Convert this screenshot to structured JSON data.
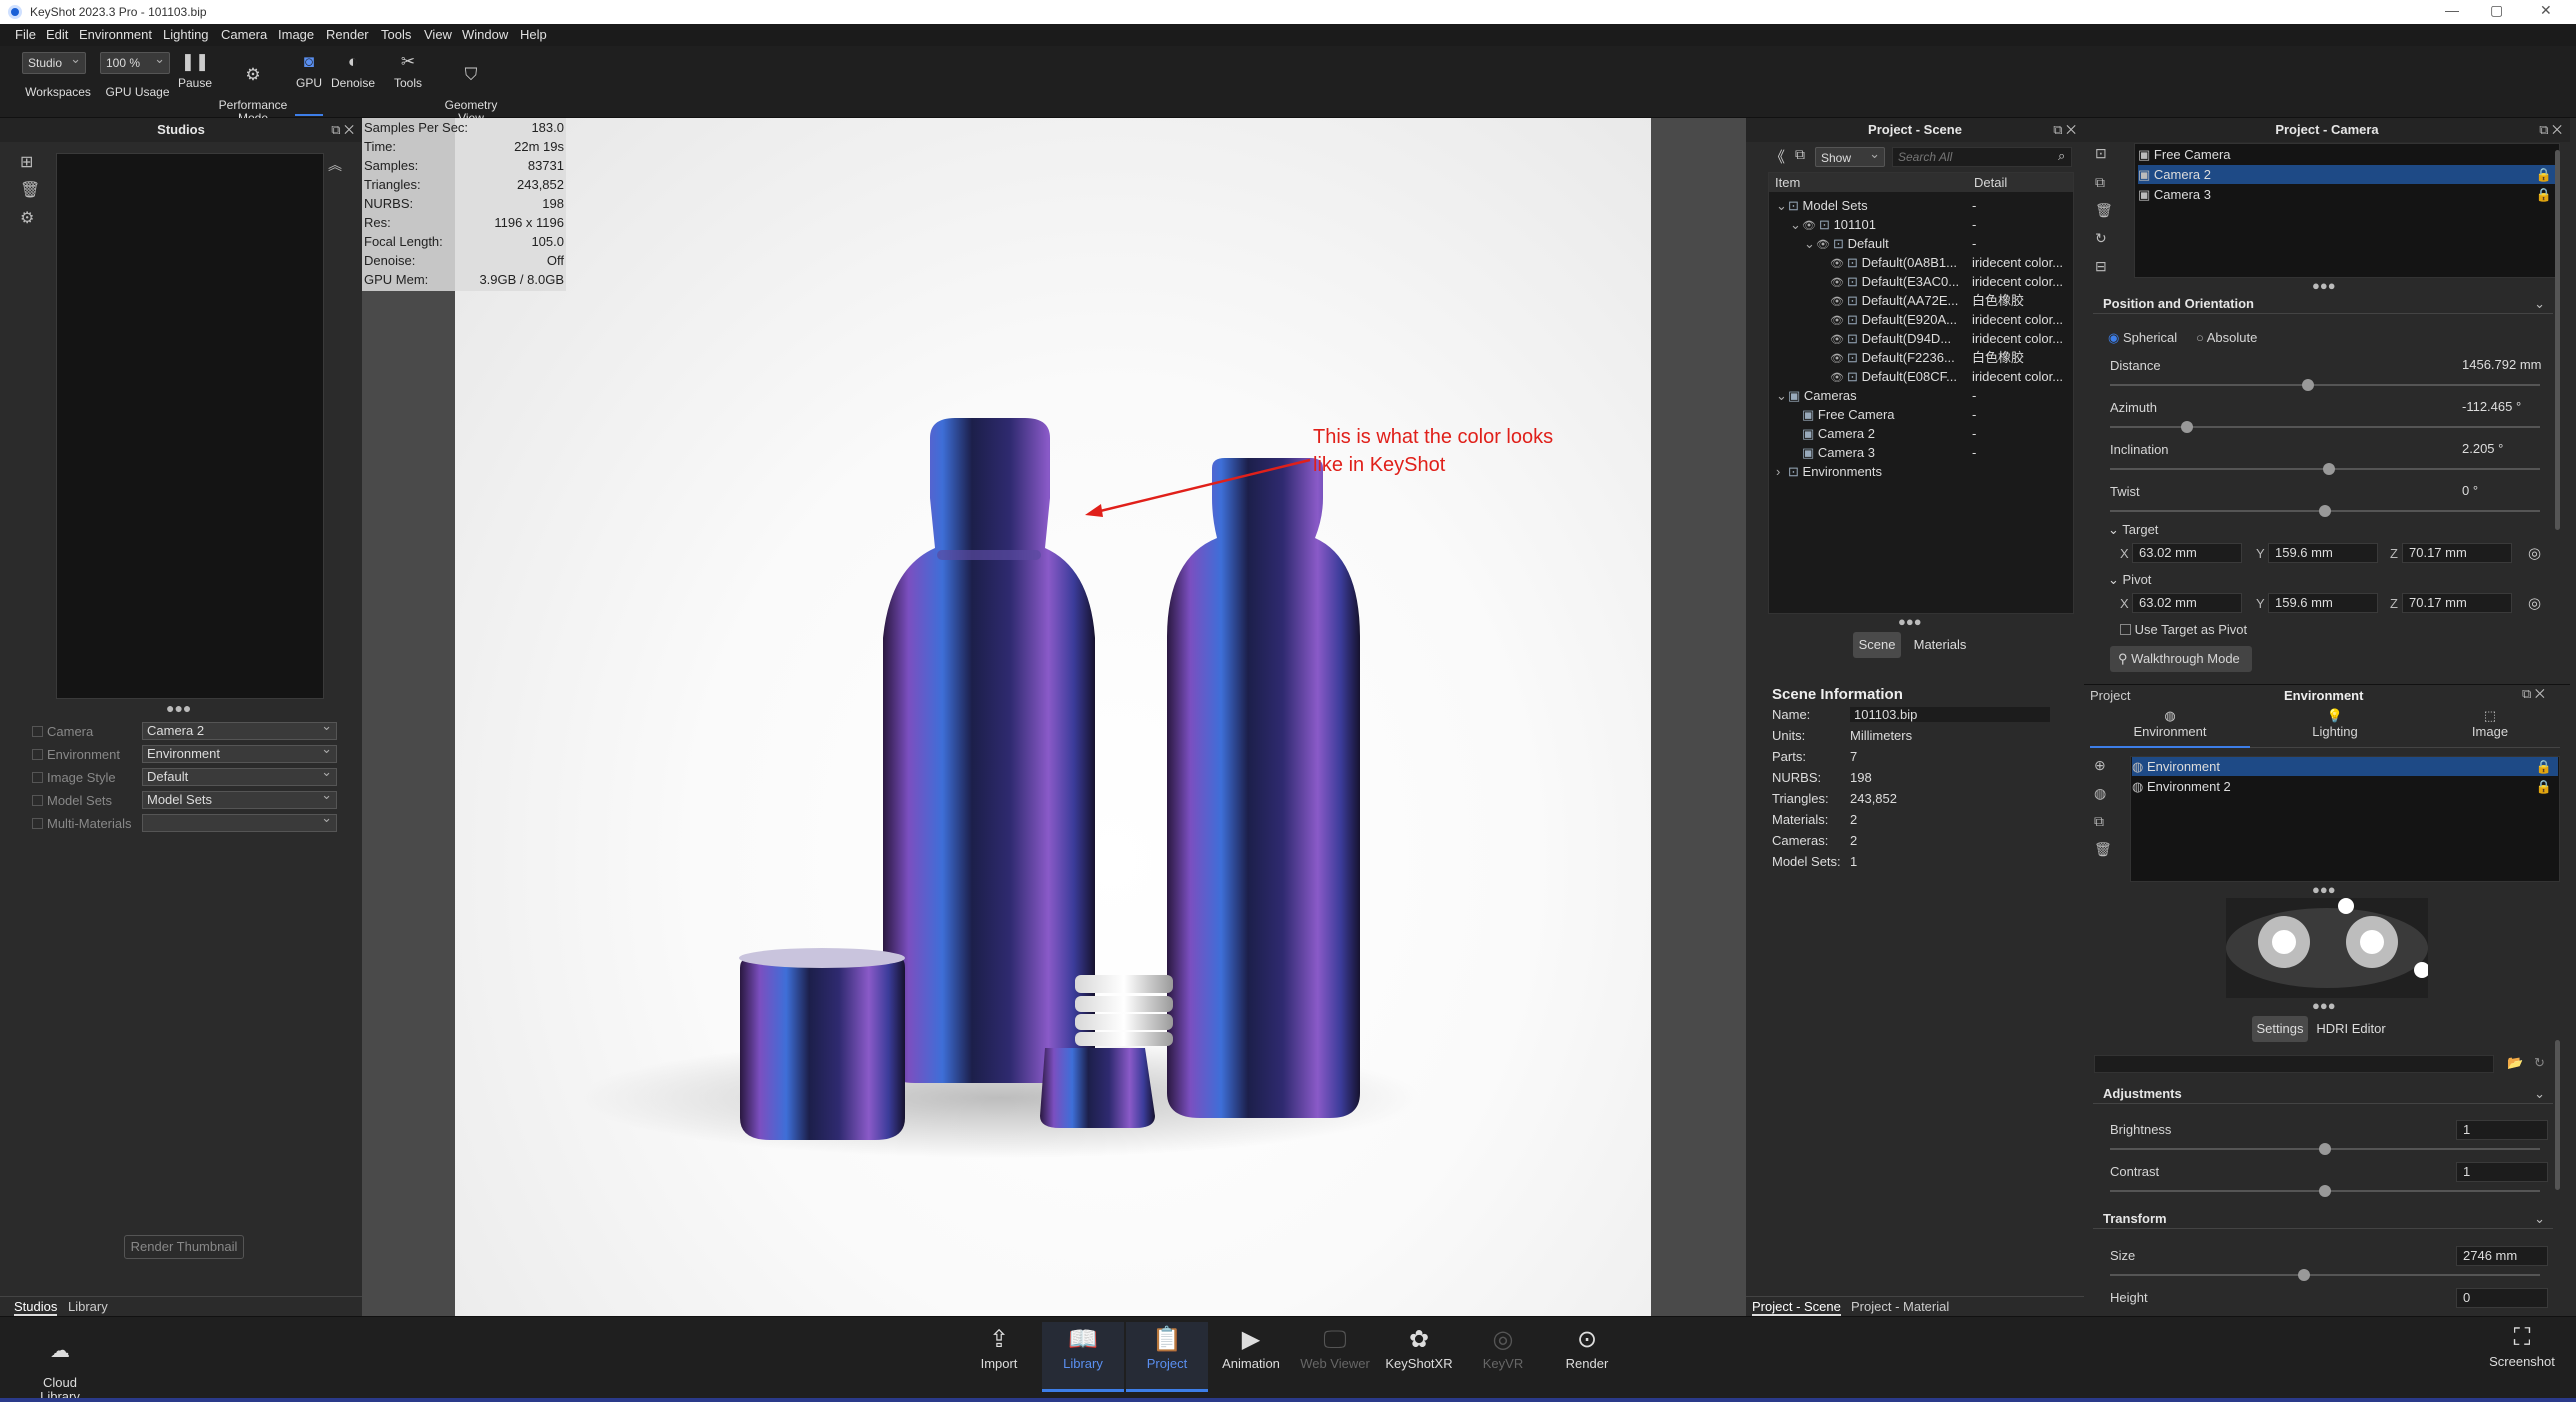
{
  "window": {
    "title": "KeyShot 2023.3 Pro - 101103.bip",
    "min": "—",
    "max": "▢",
    "close": "✕"
  },
  "menu": [
    "File",
    "Edit",
    "Environment",
    "Lighting",
    "Camera",
    "Image",
    "Render",
    "Tools",
    "View",
    "Window",
    "Help"
  ],
  "toolbar": {
    "workspace_value": "Studio",
    "workspaces_label": "Workspaces",
    "gpu_usage_value": "100 %",
    "gpu_usage_label": "GPU Usage",
    "pause_label": "Pause",
    "performance_label": "Performance\nMode",
    "gpu_label": "GPU",
    "denoise_label": "Denoise",
    "tools_label": "Tools",
    "geometry_label": "Geometry\nView"
  },
  "studios_panel": {
    "title": "Studios",
    "properties": [
      {
        "label": "Camera",
        "value": "Camera 2"
      },
      {
        "label": "Environment",
        "value": "Environment"
      },
      {
        "label": "Image Style",
        "value": "Default"
      },
      {
        "label": "Model Sets",
        "value": "Model Sets"
      },
      {
        "label": "Multi-Materials",
        "value": ""
      }
    ],
    "render_thumbnail": "Render Thumbnail",
    "tabs": [
      "Studios",
      "Library"
    ]
  },
  "render_stats": [
    {
      "k": "Samples Per Sec:",
      "v": "183.0"
    },
    {
      "k": "Time:",
      "v": "22m 19s"
    },
    {
      "k": "Samples:",
      "v": "83731"
    },
    {
      "k": "Triangles:",
      "v": "243,852"
    },
    {
      "k": "NURBS:",
      "v": "198"
    },
    {
      "k": "Res:",
      "v": "1196 x 1196"
    },
    {
      "k": "Focal Length:",
      "v": "105.0"
    },
    {
      "k": "Denoise:",
      "v": "Off"
    },
    {
      "k": "GPU Mem:",
      "v": "3.9GB / 8.0GB"
    }
  ],
  "annotation": {
    "line1": "This is what the color looks",
    "line2": "like in KeyShot",
    "color": "#e0201a"
  },
  "scene_panel": {
    "title": "Project - Scene",
    "show": "Show",
    "search_placeholder": "Search All",
    "col_item": "Item",
    "col_detail": "Detail",
    "tree": [
      {
        "label": "Model Sets",
        "detail": "-",
        "indent": 0
      },
      {
        "label": "101101",
        "detail": "-",
        "indent": 1
      },
      {
        "label": "Default",
        "detail": "-",
        "indent": 2
      },
      {
        "label": "Default(0A8B1...",
        "detail": "iridecent color...",
        "indent": 3
      },
      {
        "label": "Default(E3AC0...",
        "detail": "iridecent color...",
        "indent": 3
      },
      {
        "label": "Default(AA72E...",
        "detail": "白色橡胶",
        "indent": 3
      },
      {
        "label": "Default(E920A...",
        "detail": "iridecent color...",
        "indent": 3
      },
      {
        "label": "Default(D94D...",
        "detail": "iridecent color...",
        "indent": 3
      },
      {
        "label": "Default(F2236...",
        "detail": "白色橡胶",
        "indent": 3
      },
      {
        "label": "Default(E08CF...",
        "detail": "iridecent color...",
        "indent": 3
      },
      {
        "label": "Cameras",
        "detail": "-",
        "indent": 0
      },
      {
        "label": "Free Camera",
        "detail": "-",
        "indent": 1
      },
      {
        "label": "Camera 2",
        "detail": "-",
        "indent": 1
      },
      {
        "label": "Camera 3",
        "detail": "-",
        "indent": 1
      },
      {
        "label": "Environments",
        "detail": "",
        "indent": 0
      }
    ],
    "tabs": [
      "Scene",
      "Materials"
    ],
    "info_title": "Scene Information",
    "info": [
      {
        "k": "Name:",
        "v": "101103.bip"
      },
      {
        "k": "Units:",
        "v": "Millimeters"
      },
      {
        "k": "Parts:",
        "v": "7"
      },
      {
        "k": "NURBS:",
        "v": "198"
      },
      {
        "k": "Triangles:",
        "v": "243,852"
      },
      {
        "k": "Materials:",
        "v": "2"
      },
      {
        "k": "Cameras:",
        "v": "2"
      },
      {
        "k": "Model Sets:",
        "v": "1"
      }
    ],
    "bottom_tabs": [
      "Project - Scene",
      "Project - Material"
    ]
  },
  "camera_panel": {
    "title": "Project - Camera",
    "cameras": [
      "Free Camera",
      "Camera 2",
      "Camera 3"
    ],
    "selected": "Camera 2",
    "section": "Position and Orientation",
    "mode_spherical": "Spherical",
    "mode_absolute": "Absolute",
    "fields": [
      {
        "label": "Distance",
        "value": "1456.792 mm",
        "level": 0.46
      },
      {
        "label": "Azimuth",
        "value": "-112.465 °",
        "level": 0.18
      },
      {
        "label": "Inclination",
        "value": "2.205 °",
        "level": 0.51
      },
      {
        "label": "Twist",
        "value": "0 °",
        "level": 0.5
      }
    ],
    "target_label": "Target",
    "target": {
      "x": "63.02 mm",
      "y": "159.6 mm",
      "z": "70.17 mm"
    },
    "pivot_label": "Pivot",
    "pivot": {
      "x": "63.02 mm",
      "y": "159.6 mm",
      "z": "70.17 mm"
    },
    "use_target": "Use Target as Pivot",
    "walkthrough": "Walkthrough Mode"
  },
  "environment_panel": {
    "project_tab": "Project",
    "title": "Environment",
    "tabs": [
      "Environment",
      "Lighting",
      "Image"
    ],
    "items": [
      "Environment",
      "Environment 2"
    ],
    "settings": "Settings",
    "hdri": "HDRI Editor",
    "adjustments": "Adjustments",
    "brightness": {
      "label": "Brightness",
      "value": "1",
      "level": 0.5
    },
    "contrast": {
      "label": "Contrast",
      "value": "1",
      "level": 0.5
    },
    "transform": "Transform",
    "size": {
      "label": "Size",
      "value": "2746 mm",
      "level": 0.45
    },
    "height": {
      "label": "Height",
      "value": "0"
    }
  },
  "bottom_bar": {
    "cloud_library": "Cloud\nLibrary",
    "buttons": [
      "Import",
      "Library",
      "Project",
      "Animation",
      "Web Viewer",
      "KeyShotXR",
      "KeyVR",
      "Render"
    ],
    "active": [
      "Library",
      "Project"
    ],
    "screenshot": "Screenshot"
  }
}
